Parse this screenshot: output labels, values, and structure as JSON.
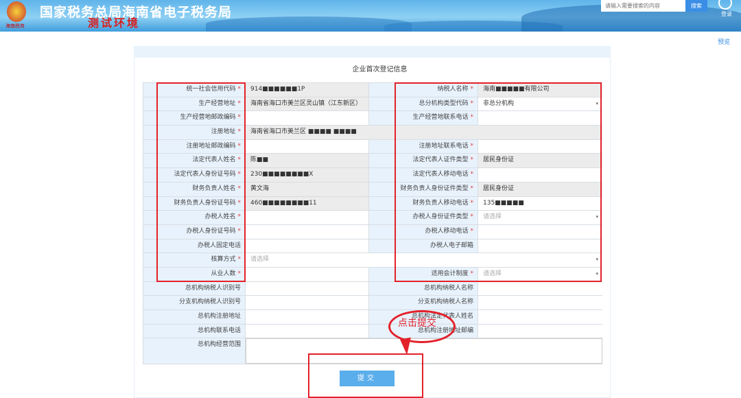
{
  "header": {
    "title": "国家税务总局海南省电子税务局",
    "env": "测试环境",
    "emblem_text": "海南税务",
    "search_placeholder": "请输入需要搜索的内容",
    "search_btn": "搜索",
    "login": "登录"
  },
  "preview": "预览",
  "form": {
    "title": "企业首次登记信息",
    "rows": [
      {
        "l1": "统一社会信用代码",
        "r1": true,
        "v1": "914■■■■■■1P",
        "ro1": true,
        "l2": "纳税人名称",
        "r2": true,
        "v2": "海南■■■■■有限公司",
        "ro2": true
      },
      {
        "l1": "生产经营地址",
        "r1": true,
        "v1": "海南省海口市美兰区灵山镇（江东新区）",
        "ro1": true,
        "l2": "总分机构类型代码",
        "r2": true,
        "v2": "非总分机构",
        "sel2": true
      },
      {
        "l1": "生产经营地邮政编码",
        "r1": true,
        "v1": "",
        "l2": "生产经营地联系电话",
        "r2": true,
        "v2": ""
      },
      {
        "l1": "注册地址",
        "r1": true,
        "full": "海南省海口市美兰区 ■■■■ ■■■■",
        "rofull": true
      },
      {
        "l1": "注册地址邮政编码",
        "r1": true,
        "v1": "",
        "l2": "注册地址联系电话",
        "r2": true,
        "v2": ""
      },
      {
        "l1": "法定代表人姓名",
        "r1": true,
        "v1": "陈■■",
        "ro1": true,
        "l2": "法定代表人证件类型",
        "r2": true,
        "v2": "居民身份证",
        "ro2": true
      },
      {
        "l1": "法定代表人身份证号码",
        "r1": true,
        "v1": "230■■■■■■■■X",
        "ro1": true,
        "l2": "法定代表人移动电话",
        "r2": true,
        "v2": ""
      },
      {
        "l1": "财务负责人姓名",
        "r1": true,
        "v1": "黄文海",
        "ro1": true,
        "l2": "财务负责人身份证件类型",
        "r2": true,
        "v2": "居民身份证",
        "ro2": true
      },
      {
        "l1": "财务负责人身份证号码",
        "r1": true,
        "v1": "460■■■■■■■■11",
        "ro1": true,
        "l2": "财务负责人移动电话",
        "r2": true,
        "v2": "135■■■■■"
      },
      {
        "l1": "办税人姓名",
        "r1": true,
        "v1": "",
        "l2": "办税人身份证件类型",
        "r2": true,
        "v2": "请选择",
        "ph2": true,
        "sel2": true
      },
      {
        "l1": "办税人身份证号码",
        "r1": true,
        "v1": "",
        "l2": "办税人移动电话",
        "r2": true,
        "v2": ""
      },
      {
        "l1": "办税人固定电话",
        "r1": false,
        "v1": "",
        "l2": "办税人电子邮箱",
        "r2": false,
        "v2": ""
      },
      {
        "l1": "核算方式",
        "r1": true,
        "full": "请选择",
        "phfull": true,
        "selfull": true
      },
      {
        "l1": "从业人数",
        "r1": true,
        "v1": "",
        "l2": "适用会计制度",
        "r2": true,
        "v2": "请选择",
        "ph2": true,
        "sel2": true
      },
      {
        "l1": "总机构纳税人识别号",
        "r1": false,
        "v1": "",
        "l2": "总机构纳税人名称",
        "r2": false,
        "v2": ""
      },
      {
        "l1": "分支机构纳税人识别号",
        "r1": false,
        "v1": "",
        "l2": "分支机构纳税人名称",
        "r2": false,
        "v2": ""
      },
      {
        "l1": "总机构注册地址",
        "r1": false,
        "v1": "",
        "l2": "总机构法定代表人姓名",
        "r2": false,
        "v2": ""
      },
      {
        "l1": "总机构联系电话",
        "r1": false,
        "v1": "",
        "l2": "总机构注册地址邮编",
        "r2": false,
        "v2": ""
      },
      {
        "l1": "总机构经营范围",
        "r1": false,
        "full": "",
        "textarea": true
      }
    ],
    "required_mark": "*",
    "submit": "提交"
  },
  "annotation": {
    "text": "点击提交",
    "color": "#e3202a"
  }
}
